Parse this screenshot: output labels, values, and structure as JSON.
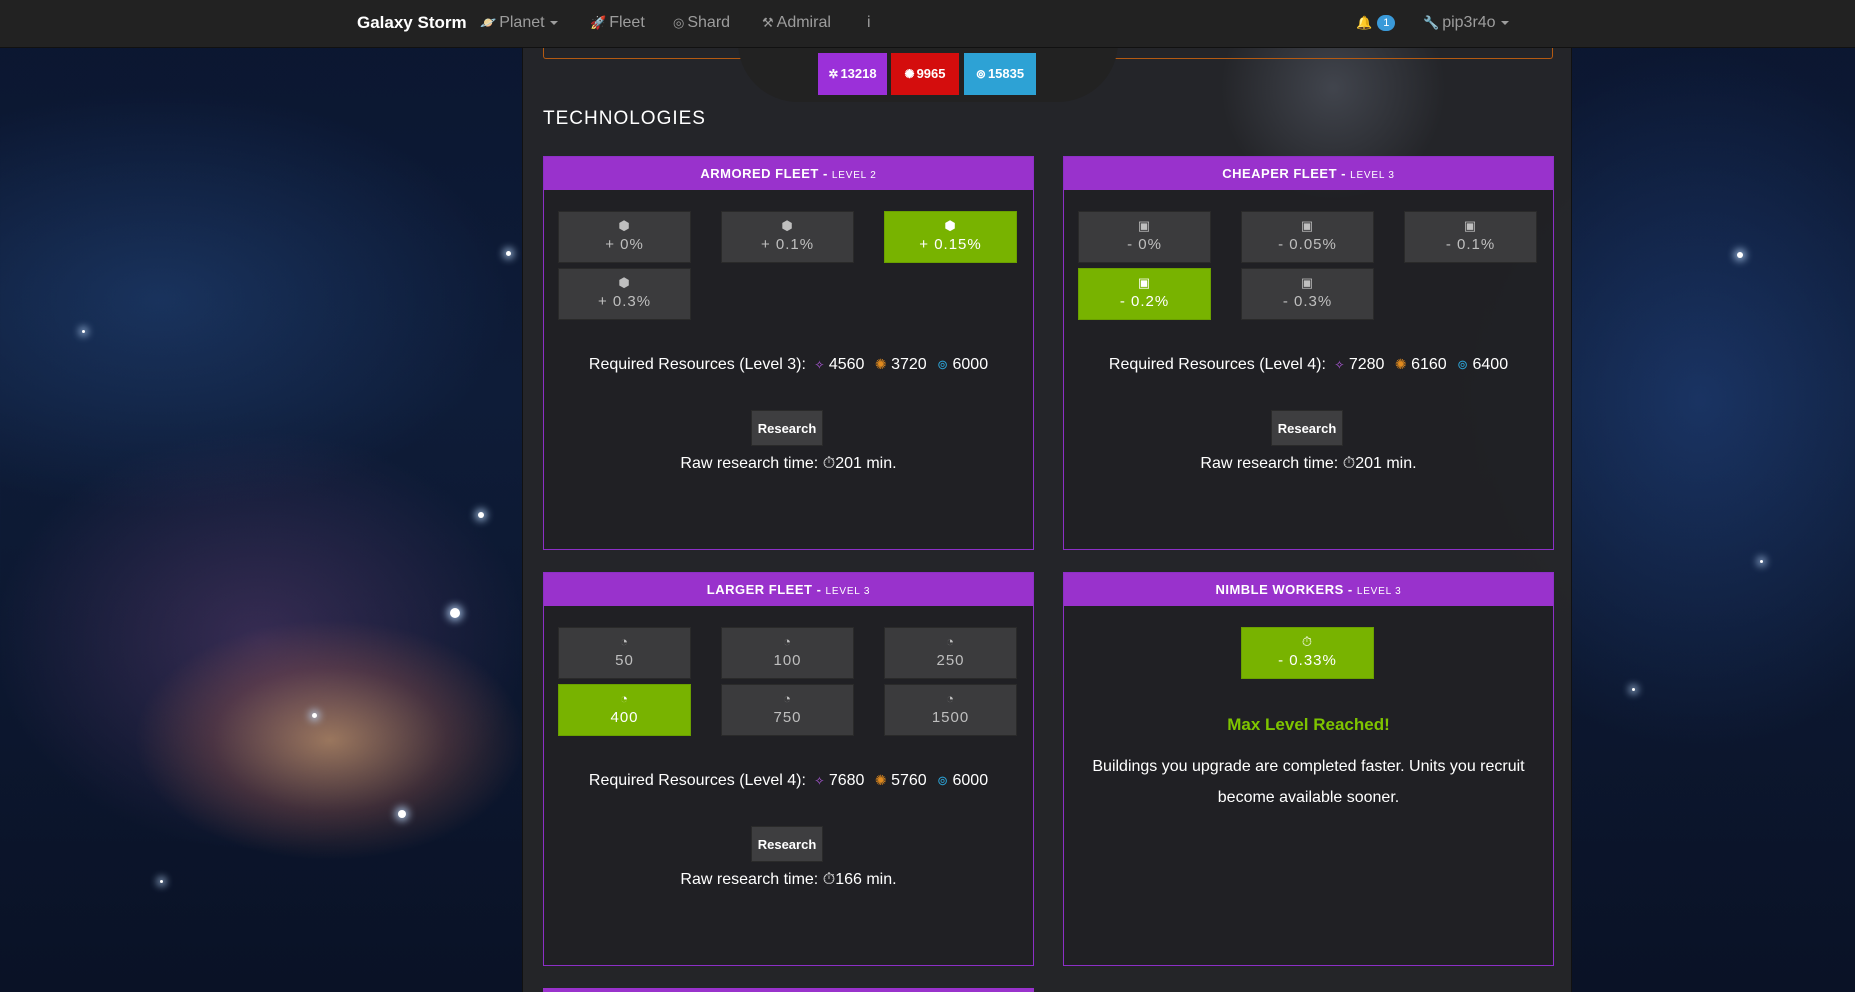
{
  "nav": {
    "brand": "Galaxy Storm",
    "items": [
      {
        "label": "Planet",
        "icon": "planet-icon",
        "glyph": "🪐"
      },
      {
        "label": "Fleet",
        "icon": "rocket-icon",
        "glyph": "🚀"
      },
      {
        "label": "Shard",
        "icon": "shard-icon",
        "glyph": "◎"
      },
      {
        "label": "Admiral",
        "icon": "tools-icon",
        "glyph": "⚒"
      },
      {
        "label": "i",
        "icon": "info-icon"
      }
    ],
    "notifications": "1",
    "user": "pip3r4o"
  },
  "resources": {
    "crystal": "13218",
    "metal": "9965",
    "gas": "15835"
  },
  "section_title": "TECHNOLOGIES",
  "cards": [
    {
      "title": "ARMORED FLEET",
      "level": "LEVEL 2",
      "option_icon": "cube-icon",
      "options": [
        "+ 0%",
        "+ 0.1%",
        "+ 0.15%",
        "+ 0.3%"
      ],
      "active_index": 2,
      "required_label": "Required Resources (Level 3):",
      "crystal": "4560",
      "metal": "3720",
      "gas": "6000",
      "button": "Research",
      "time_label": "Raw research time:",
      "time_value": "201 min."
    },
    {
      "title": "CHEAPER FLEET",
      "level": "LEVEL 3",
      "option_icon": "money-icon",
      "options": [
        "- 0%",
        "- 0.05%",
        "- 0.1%",
        "- 0.2%",
        "- 0.3%"
      ],
      "active_index": 3,
      "required_label": "Required Resources (Level 4):",
      "crystal": "7280",
      "metal": "6160",
      "gas": "6400",
      "button": "Research",
      "time_label": "Raw research time:",
      "time_value": "201 min."
    },
    {
      "title": "LARGER FLEET",
      "level": "LEVEL 3",
      "option_icon": "gauge-icon",
      "options": [
        "50",
        "100",
        "250",
        "400",
        "750",
        "1500"
      ],
      "active_index": 3,
      "required_label": "Required Resources (Level 4):",
      "crystal": "7680",
      "metal": "5760",
      "gas": "6000",
      "button": "Research",
      "time_label": "Raw research time:",
      "time_value": "166 min."
    },
    {
      "title": "NIMBLE WORKERS",
      "level": "LEVEL 3",
      "option_icon": "stopwatch-icon",
      "options": [
        "- 0.33%"
      ],
      "active_index": 0,
      "max_text": "Max Level Reached!",
      "description": "Buildings you upgrade are completed faster. Units you recruit become available sooner."
    }
  ]
}
